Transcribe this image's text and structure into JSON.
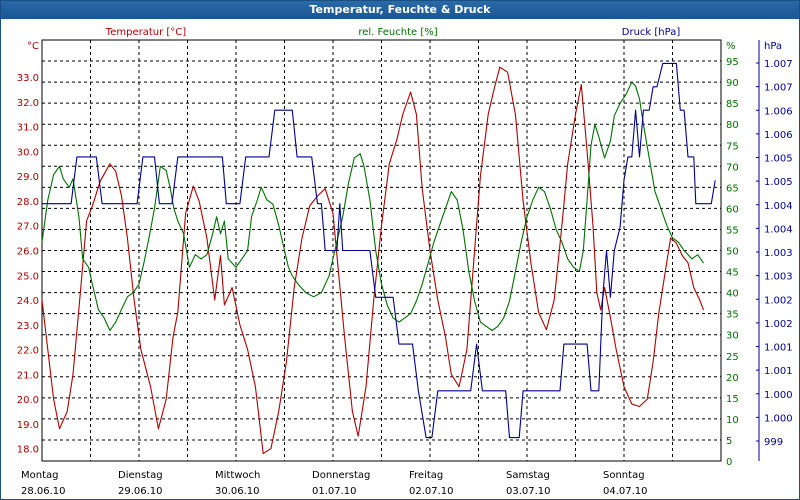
{
  "window": {
    "title": "Temperatur, Feuchte & Druck"
  },
  "colors": {
    "temperature": "#b00000",
    "humidity": "#007000",
    "pressure": "#000090",
    "grid": "#000000"
  },
  "chart_data": {
    "type": "line",
    "title": "Temperatur, Feuchte & Druck",
    "grid": true,
    "legend": "top",
    "x_labels": [
      {
        "day": "Montag",
        "date": "28.06.10"
      },
      {
        "day": "Dienstag",
        "date": "29.06.10"
      },
      {
        "day": "Mittwoch",
        "date": "30.06.10"
      },
      {
        "day": "Donnerstag",
        "date": "01.07.10"
      },
      {
        "day": "Freitag",
        "date": "02.07.10"
      },
      {
        "day": "Samstag",
        "date": "03.07.10"
      },
      {
        "day": "Sonntag",
        "date": "04.07.10"
      }
    ],
    "x_range_days": [
      0,
      7
    ],
    "axes": {
      "temperature": {
        "label": "Temperatur [°C]",
        "unit": "°C",
        "range": [
          17.5,
          34.5
        ],
        "ticks": [
          "33.0",
          "32.0",
          "31.0",
          "30.0",
          "29.0",
          "28.0",
          "27.0",
          "26.0",
          "25.0",
          "24.0",
          "23.0",
          "22.0",
          "21.0",
          "20.0",
          "19.0",
          "18.0"
        ]
      },
      "humidity": {
        "label": "rel. Feuchte [%]",
        "unit": "%",
        "range": [
          0,
          100
        ],
        "ticks": [
          "95",
          "90",
          "85",
          "80",
          "75",
          "70",
          "65",
          "60",
          "55",
          "50",
          "45",
          "40",
          "35",
          "30",
          "25",
          "20",
          "15",
          "10",
          "5",
          "0"
        ]
      },
      "pressure": {
        "label": "Druck [hPa]",
        "unit": "hPa",
        "range": [
          998.5,
          1007.5
        ],
        "ticks": [
          "1.007",
          "1.007",
          "1.006",
          "1.006",
          "1.005",
          "1.005",
          "1.004",
          "1.004",
          "1.003",
          "1.003",
          "1.002",
          "1.002",
          "1.001",
          "1.001",
          "1.000",
          "1.000",
          "999"
        ]
      }
    },
    "series": [
      {
        "name": "Temperatur [°C]",
        "axis": "temperature",
        "points": [
          [
            0.0,
            24.0
          ],
          [
            0.06,
            22.0
          ],
          [
            0.12,
            20.0
          ],
          [
            0.18,
            18.8
          ],
          [
            0.26,
            19.5
          ],
          [
            0.32,
            21.0
          ],
          [
            0.4,
            24.5
          ],
          [
            0.46,
            27.2
          ],
          [
            0.52,
            27.8
          ],
          [
            0.6,
            28.8
          ],
          [
            0.7,
            29.5
          ],
          [
            0.76,
            29.2
          ],
          [
            0.82,
            28.2
          ],
          [
            0.88,
            26.5
          ],
          [
            0.95,
            24.0
          ],
          [
            1.02,
            22.0
          ],
          [
            1.12,
            20.5
          ],
          [
            1.2,
            18.8
          ],
          [
            1.28,
            20.0
          ],
          [
            1.35,
            22.5
          ],
          [
            1.4,
            23.5
          ],
          [
            1.48,
            27.5
          ],
          [
            1.56,
            28.6
          ],
          [
            1.62,
            28.0
          ],
          [
            1.7,
            26.5
          ],
          [
            1.78,
            24.0
          ],
          [
            1.84,
            25.8
          ],
          [
            1.88,
            23.8
          ],
          [
            1.96,
            24.5
          ],
          [
            2.04,
            23.0
          ],
          [
            2.12,
            22.0
          ],
          [
            2.2,
            20.5
          ],
          [
            2.28,
            17.8
          ],
          [
            2.36,
            18.0
          ],
          [
            2.44,
            19.5
          ],
          [
            2.52,
            21.5
          ],
          [
            2.6,
            24.5
          ],
          [
            2.68,
            26.5
          ],
          [
            2.76,
            27.8
          ],
          [
            2.84,
            28.2
          ],
          [
            2.92,
            28.5
          ],
          [
            3.0,
            27.5
          ],
          [
            3.06,
            25.0
          ],
          [
            3.12,
            22.5
          ],
          [
            3.2,
            19.5
          ],
          [
            3.26,
            18.5
          ],
          [
            3.34,
            20.5
          ],
          [
            3.42,
            24.0
          ],
          [
            3.5,
            27.0
          ],
          [
            3.58,
            29.5
          ],
          [
            3.66,
            30.5
          ],
          [
            3.72,
            31.5
          ],
          [
            3.8,
            32.4
          ],
          [
            3.86,
            31.5
          ],
          [
            3.92,
            28.5
          ],
          [
            4.0,
            26.0
          ],
          [
            4.08,
            24.0
          ],
          [
            4.16,
            22.5
          ],
          [
            4.22,
            21.0
          ],
          [
            4.3,
            20.5
          ],
          [
            4.38,
            22.0
          ],
          [
            4.46,
            26.0
          ],
          [
            4.52,
            29.0
          ],
          [
            4.6,
            31.5
          ],
          [
            4.66,
            32.5
          ],
          [
            4.72,
            33.4
          ],
          [
            4.8,
            33.2
          ],
          [
            4.88,
            31.5
          ],
          [
            4.96,
            28.0
          ],
          [
            5.04,
            25.5
          ],
          [
            5.12,
            23.5
          ],
          [
            5.2,
            22.8
          ],
          [
            5.28,
            24.0
          ],
          [
            5.36,
            27.0
          ],
          [
            5.42,
            29.5
          ],
          [
            5.5,
            31.5
          ],
          [
            5.56,
            32.7
          ],
          [
            5.62,
            30.0
          ],
          [
            5.68,
            27.0
          ],
          [
            5.72,
            24.3
          ],
          [
            5.76,
            23.6
          ],
          [
            5.8,
            24.5
          ],
          [
            5.86,
            23.3
          ],
          [
            5.92,
            22.0
          ],
          [
            6.0,
            20.5
          ],
          [
            6.08,
            19.8
          ],
          [
            6.16,
            19.7
          ],
          [
            6.24,
            20.0
          ],
          [
            6.3,
            21.5
          ],
          [
            6.36,
            23.5
          ],
          [
            6.42,
            25.0
          ],
          [
            6.48,
            26.5
          ],
          [
            6.54,
            26.3
          ],
          [
            6.6,
            25.8
          ],
          [
            6.66,
            25.5
          ],
          [
            6.72,
            24.5
          ],
          [
            6.78,
            24.0
          ],
          [
            6.82,
            23.6
          ]
        ]
      },
      {
        "name": "rel. Feuchte [%]",
        "axis": "humidity",
        "points": [
          [
            0.0,
            52
          ],
          [
            0.06,
            62
          ],
          [
            0.12,
            68
          ],
          [
            0.18,
            70
          ],
          [
            0.22,
            67
          ],
          [
            0.28,
            65
          ],
          [
            0.32,
            67
          ],
          [
            0.38,
            58
          ],
          [
            0.42,
            48
          ],
          [
            0.48,
            46
          ],
          [
            0.52,
            42
          ],
          [
            0.58,
            36
          ],
          [
            0.64,
            34
          ],
          [
            0.7,
            31
          ],
          [
            0.76,
            33
          ],
          [
            0.82,
            36
          ],
          [
            0.88,
            39
          ],
          [
            0.94,
            40
          ],
          [
            1.0,
            42
          ],
          [
            1.06,
            48
          ],
          [
            1.12,
            55
          ],
          [
            1.16,
            60
          ],
          [
            1.22,
            70
          ],
          [
            1.28,
            69
          ],
          [
            1.32,
            65
          ],
          [
            1.36,
            60
          ],
          [
            1.4,
            57
          ],
          [
            1.46,
            54
          ],
          [
            1.52,
            46
          ],
          [
            1.58,
            49
          ],
          [
            1.64,
            48
          ],
          [
            1.7,
            49
          ],
          [
            1.76,
            54
          ],
          [
            1.8,
            58
          ],
          [
            1.84,
            54
          ],
          [
            1.88,
            57
          ],
          [
            1.92,
            48
          ],
          [
            2.0,
            46
          ],
          [
            2.06,
            48
          ],
          [
            2.12,
            50
          ],
          [
            2.16,
            58
          ],
          [
            2.22,
            62
          ],
          [
            2.26,
            65
          ],
          [
            2.32,
            62
          ],
          [
            2.38,
            61
          ],
          [
            2.44,
            56
          ],
          [
            2.5,
            50
          ],
          [
            2.54,
            46
          ],
          [
            2.58,
            44
          ],
          [
            2.64,
            42
          ],
          [
            2.72,
            40
          ],
          [
            2.8,
            39
          ],
          [
            2.88,
            40
          ],
          [
            2.96,
            44
          ],
          [
            3.02,
            50
          ],
          [
            3.1,
            58
          ],
          [
            3.16,
            66
          ],
          [
            3.22,
            72
          ],
          [
            3.28,
            73
          ],
          [
            3.32,
            70
          ],
          [
            3.38,
            62
          ],
          [
            3.44,
            50
          ],
          [
            3.5,
            42
          ],
          [
            3.56,
            37
          ],
          [
            3.62,
            34
          ],
          [
            3.68,
            33
          ],
          [
            3.74,
            34
          ],
          [
            3.8,
            35
          ],
          [
            3.86,
            38
          ],
          [
            3.92,
            42
          ],
          [
            3.98,
            47
          ],
          [
            4.04,
            52
          ],
          [
            4.1,
            56
          ],
          [
            4.16,
            60
          ],
          [
            4.22,
            64
          ],
          [
            4.28,
            62
          ],
          [
            4.34,
            55
          ],
          [
            4.4,
            45
          ],
          [
            4.46,
            38
          ],
          [
            4.52,
            33
          ],
          [
            4.58,
            32
          ],
          [
            4.64,
            31
          ],
          [
            4.7,
            32
          ],
          [
            4.76,
            34
          ],
          [
            4.82,
            38
          ],
          [
            4.88,
            45
          ],
          [
            4.94,
            52
          ],
          [
            5.0,
            58
          ],
          [
            5.06,
            62
          ],
          [
            5.12,
            65
          ],
          [
            5.18,
            64
          ],
          [
            5.24,
            60
          ],
          [
            5.3,
            55
          ],
          [
            5.36,
            52
          ],
          [
            5.42,
            48
          ],
          [
            5.48,
            46
          ],
          [
            5.54,
            45
          ],
          [
            5.58,
            50
          ],
          [
            5.62,
            62
          ],
          [
            5.66,
            75
          ],
          [
            5.7,
            80
          ],
          [
            5.74,
            77
          ],
          [
            5.8,
            72
          ],
          [
            5.86,
            76
          ],
          [
            5.9,
            82
          ],
          [
            5.96,
            85
          ],
          [
            6.02,
            87
          ],
          [
            6.08,
            90
          ],
          [
            6.12,
            89
          ],
          [
            6.16,
            86
          ],
          [
            6.2,
            80
          ],
          [
            6.26,
            72
          ],
          [
            6.32,
            64
          ],
          [
            6.38,
            60
          ],
          [
            6.44,
            56
          ],
          [
            6.5,
            53
          ],
          [
            6.56,
            52
          ],
          [
            6.62,
            50
          ],
          [
            6.7,
            48
          ],
          [
            6.76,
            49
          ],
          [
            6.82,
            47
          ]
        ]
      },
      {
        "name": "Druck [hPa]",
        "axis": "pressure",
        "points": [
          [
            0.0,
            1004.0
          ],
          [
            0.3,
            1004.0
          ],
          [
            0.36,
            1005.0
          ],
          [
            0.56,
            1005.0
          ],
          [
            0.62,
            1004.0
          ],
          [
            0.98,
            1004.0
          ],
          [
            1.04,
            1005.0
          ],
          [
            1.16,
            1005.0
          ],
          [
            1.21,
            1004.0
          ],
          [
            1.34,
            1004.0
          ],
          [
            1.4,
            1005.0
          ],
          [
            1.86,
            1005.0
          ],
          [
            1.9,
            1004.0
          ],
          [
            2.04,
            1004.0
          ],
          [
            2.1,
            1005.0
          ],
          [
            2.34,
            1005.0
          ],
          [
            2.4,
            1006.0
          ],
          [
            2.58,
            1006.0
          ],
          [
            2.63,
            1005.0
          ],
          [
            2.78,
            1005.0
          ],
          [
            2.84,
            1004.0
          ],
          [
            2.88,
            1004.0
          ],
          [
            2.92,
            1003.0
          ],
          [
            3.04,
            1003.0
          ],
          [
            3.07,
            1004.0
          ],
          [
            3.1,
            1003.0
          ],
          [
            3.38,
            1003.0
          ],
          [
            3.44,
            1002.0
          ],
          [
            3.62,
            1002.0
          ],
          [
            3.68,
            1001.0
          ],
          [
            3.82,
            1001.0
          ],
          [
            3.88,
            1000.0
          ],
          [
            3.96,
            999.0
          ],
          [
            4.02,
            999.0
          ],
          [
            4.08,
            1000.0
          ],
          [
            4.42,
            1000.0
          ],
          [
            4.48,
            1001.0
          ],
          [
            4.54,
            1000.0
          ],
          [
            4.78,
            1000.0
          ],
          [
            4.82,
            999.0
          ],
          [
            4.92,
            999.0
          ],
          [
            4.96,
            1000.0
          ],
          [
            5.34,
            1000.0
          ],
          [
            5.38,
            1001.0
          ],
          [
            5.62,
            1001.0
          ],
          [
            5.66,
            1000.0
          ],
          [
            5.74,
            1000.0
          ],
          [
            5.78,
            1002.0
          ],
          [
            5.82,
            1003.0
          ],
          [
            5.86,
            1002.0
          ],
          [
            5.9,
            1003.0
          ],
          [
            5.96,
            1003.5
          ],
          [
            6.0,
            1004.5
          ],
          [
            6.04,
            1005.0
          ],
          [
            6.08,
            1005.0
          ],
          [
            6.12,
            1006.0
          ],
          [
            6.16,
            1005.0
          ],
          [
            6.2,
            1006.0
          ],
          [
            6.26,
            1006.0
          ],
          [
            6.3,
            1006.5
          ],
          [
            6.34,
            1006.5
          ],
          [
            6.4,
            1007.0
          ],
          [
            6.54,
            1007.0
          ],
          [
            6.58,
            1006.0
          ],
          [
            6.62,
            1006.0
          ],
          [
            6.66,
            1005.0
          ],
          [
            6.72,
            1005.0
          ],
          [
            6.74,
            1004.0
          ],
          [
            6.9,
            1004.0
          ],
          [
            6.94,
            1004.5
          ]
        ]
      }
    ]
  }
}
